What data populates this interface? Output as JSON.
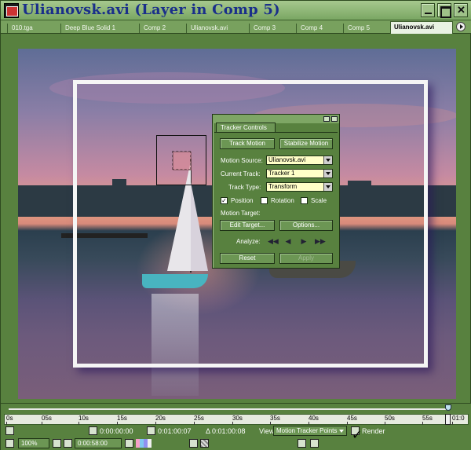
{
  "window": {
    "title": "Ulianovsk.avi (Layer in Comp 5)"
  },
  "tabs": [
    {
      "label": "010.tga"
    },
    {
      "label": "Deep Blue Solid 1"
    },
    {
      "label": "Comp 2"
    },
    {
      "label": "Ulianovsk.avi"
    },
    {
      "label": "Comp 3"
    },
    {
      "label": "Comp 4"
    },
    {
      "label": "Comp 5"
    },
    {
      "label": "Ulianovsk.avi"
    }
  ],
  "tracker": {
    "tab_label": "Tracker Controls",
    "track_motion": "Track Motion",
    "stabilize_motion": "Stabilize Motion",
    "motion_source_label": "Motion Source:",
    "motion_source_value": "Ulianovsk.avi",
    "current_track_label": "Current Track:",
    "current_track_value": "Tracker 1",
    "track_type_label": "Track Type:",
    "track_type_value": "Transform",
    "position_label": "Position",
    "position_checked": true,
    "rotation_label": "Rotation",
    "rotation_checked": false,
    "scale_label": "Scale",
    "scale_checked": false,
    "motion_target_label": "Motion Target:",
    "edit_target": "Edit Target...",
    "options": "Options...",
    "analyze_label": "Analyze:",
    "reset": "Reset",
    "apply": "Apply"
  },
  "timeline": {
    "ruler_ticks": [
      "0s",
      "05s",
      "10s",
      "15s",
      "20s",
      "25s",
      "30s",
      "35s",
      "40s",
      "45s",
      "50s",
      "55s",
      "01:0"
    ],
    "start_time": "0:00:00:00",
    "end_time": "0:01:00:07",
    "duration": "Δ 0:01:00:08",
    "view_label": "View:",
    "view_value": "Motion Tracker Points",
    "render_label": "Render",
    "render_checked": true,
    "zoom": "100%",
    "current_time": "0:00:58:00"
  }
}
